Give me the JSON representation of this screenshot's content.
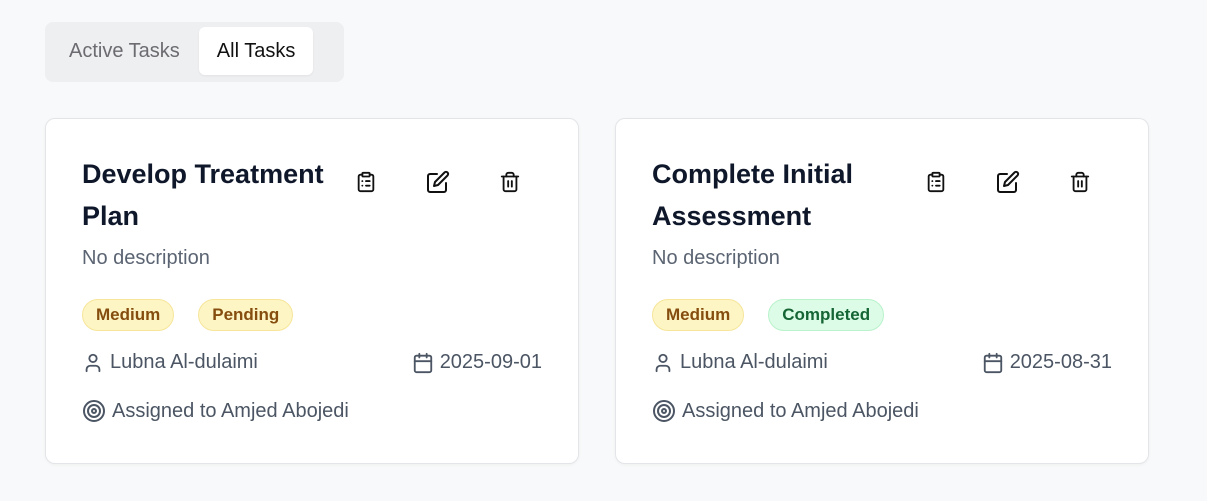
{
  "tabs": [
    {
      "label": "Active Tasks",
      "active": false
    },
    {
      "label": "All Tasks",
      "active": true
    }
  ],
  "cards": [
    {
      "title": "Develop Treatment Plan",
      "description": "No description",
      "priority": "Medium",
      "status": "Pending",
      "owner": "Lubna Al-dulaimi",
      "date": "2025-09-01",
      "assigned": "Assigned to Amjed Abojedi"
    },
    {
      "title": "Complete Initial Assessment",
      "description": "No description",
      "priority": "Medium",
      "status": "Completed",
      "owner": "Lubna Al-dulaimi",
      "date": "2025-08-31",
      "assigned": "Assigned to Amjed Abojedi"
    }
  ],
  "icons": {
    "clipboard": "clipboard-icon",
    "edit": "edit-icon",
    "delete": "trash-icon",
    "user": "user-icon",
    "calendar": "calendar-icon",
    "target": "target-icon"
  },
  "colors": {
    "priority_bg": "#fdf5c4",
    "priority_text": "#854d0e",
    "completed_bg": "#dcfce7",
    "completed_text": "#166534"
  }
}
